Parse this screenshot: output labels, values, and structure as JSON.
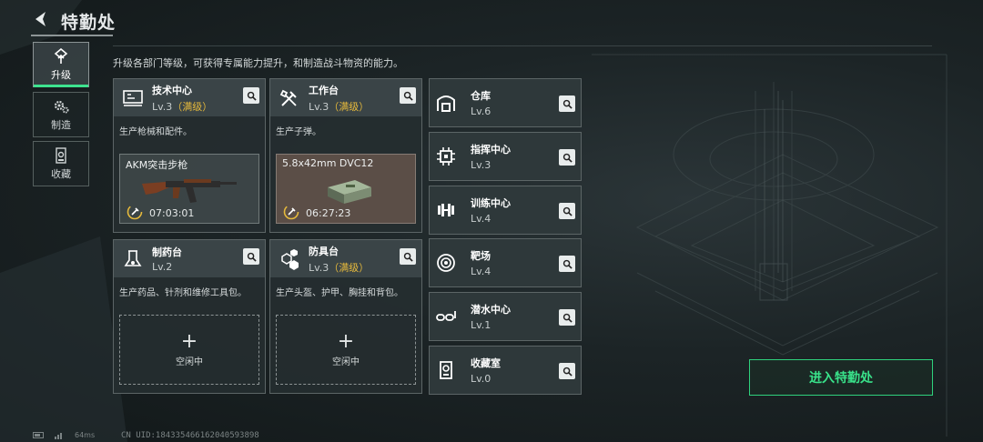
{
  "header": {
    "title": "特勤处"
  },
  "tabs": [
    {
      "label": "升级",
      "icon": "upgrade-icon",
      "active": true
    },
    {
      "label": "制造",
      "icon": "gears-icon",
      "active": false
    },
    {
      "label": "收藏",
      "icon": "collection-icon",
      "active": false
    }
  ],
  "subtitle": "升级各部门等级，可获得专属能力提升，和制造战斗物资的能力。",
  "cards": [
    {
      "name": "技术中心",
      "level": "Lv.3",
      "max": "（满级）",
      "icon": "tech-center-icon",
      "desc": "生产枪械和配件。",
      "production": {
        "item": "AKM突击步枪",
        "timer": "07:03:01"
      }
    },
    {
      "name": "工作台",
      "level": "Lv.3",
      "max": "（满级）",
      "icon": "workbench-icon",
      "desc": "生产子弹。",
      "production": {
        "item": "5.8x42mm DVC12",
        "timer": "06:27:23"
      }
    },
    {
      "name": "制药台",
      "level": "Lv.2",
      "max": "",
      "icon": "pharmacy-icon",
      "desc": "生产药品、针剂和维修工具包。",
      "empty": {
        "plus": "+",
        "label": "空闲中"
      }
    },
    {
      "name": "防具台",
      "level": "Lv.3",
      "max": "（满级）",
      "icon": "armor-bench-icon",
      "desc": "生产头盔、护甲、胸挂和背包。",
      "empty": {
        "plus": "+",
        "label": "空闲中"
      }
    }
  ],
  "facilities": [
    {
      "name": "仓库",
      "level": "Lv.6",
      "icon": "warehouse-icon"
    },
    {
      "name": "指挥中心",
      "level": "Lv.3",
      "icon": "command-center-icon"
    },
    {
      "name": "训练中心",
      "level": "Lv.4",
      "icon": "dumbbell-icon"
    },
    {
      "name": "靶场",
      "level": "Lv.4",
      "icon": "target-icon"
    },
    {
      "name": "潜水中心",
      "level": "Lv.1",
      "icon": "diving-mask-icon"
    },
    {
      "name": "收藏室",
      "level": "Lv.0",
      "icon": "trophy-room-icon"
    }
  ],
  "enter_button": "进入特勤处",
  "footer": {
    "ping": "64ms",
    "uid": "CN UID:1843354661620405938​98"
  },
  "colors": {
    "accent": "#3de38f",
    "max_level": "#e5b93c",
    "button": "#39e28a"
  }
}
